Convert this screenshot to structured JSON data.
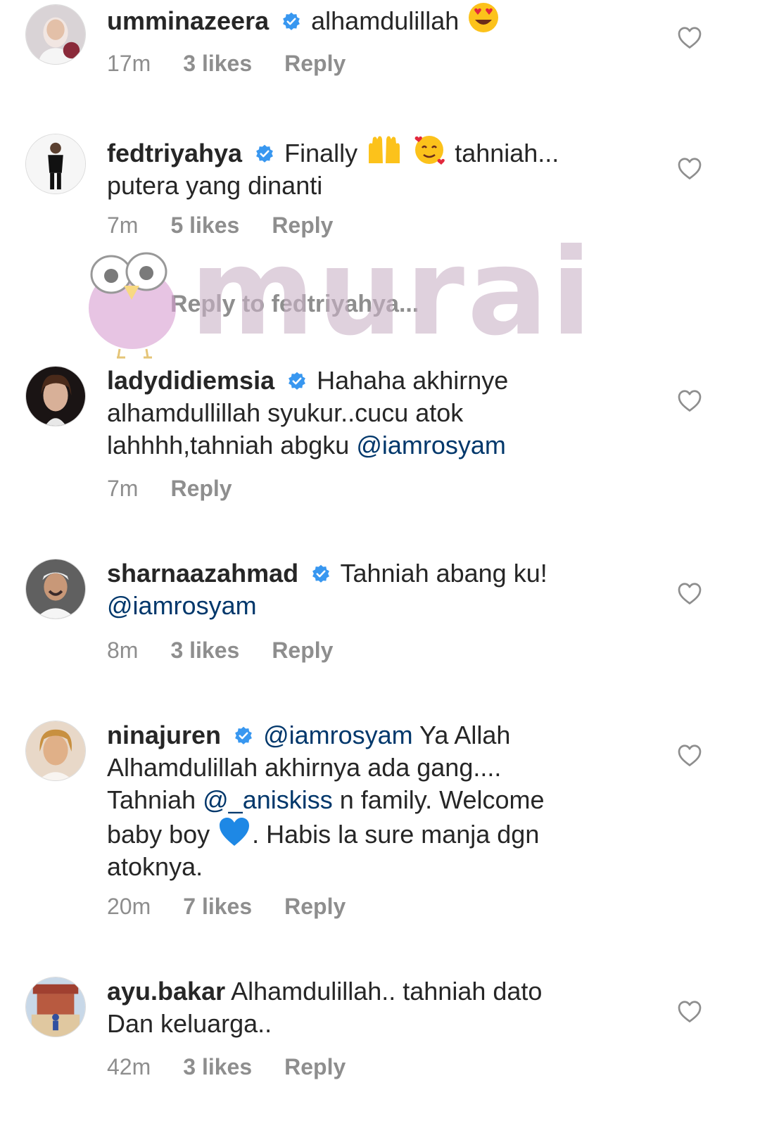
{
  "comments": [
    {
      "username": "umminazeera",
      "verified": true,
      "text": "alhamdulillah",
      "emojis": [
        "heart-eyes"
      ],
      "time": "17m",
      "likes": "3 likes",
      "reply": "Reply",
      "avatar_color": "#7a4a5a"
    },
    {
      "username": "fedtriyahya",
      "verified": true,
      "text_lines": [
        "Finally",
        "tahniah...",
        "putera yang dinanti"
      ],
      "emojis": [
        "raised-hands",
        "smiling-hearts"
      ],
      "time": "7m",
      "likes": "5 likes",
      "reply": "Reply",
      "avatar_color": "#f2f2f2"
    },
    {
      "username": "ladydidiemsia",
      "verified": true,
      "text_lines": [
        "Hahaha akhirnye",
        "alhamdullillah syukur..cucu atok",
        "lahhhh,tahniah abgku"
      ],
      "mention": "@iamrosyam",
      "time": "7m",
      "reply": "Reply",
      "avatar_color": "#2d2020"
    },
    {
      "username": "sharnaazahmad",
      "verified": true,
      "text": "Tahniah abang ku!",
      "mention": "@iamrosyam",
      "time": "8m",
      "likes": "3 likes",
      "reply": "Reply",
      "avatar_color": "#3a3a3a"
    },
    {
      "username": "ninajuren",
      "verified": true,
      "mention1": "@iamrosyam",
      "text_lines": [
        "Ya Allah",
        "Alhamdulillah akhirnya ada gang....",
        "Tahniah",
        "n family. Welcome",
        "baby boy",
        ". Habis la sure manja dgn",
        "atoknya."
      ],
      "mention2": "@_aniskiss",
      "emojis": [
        "blue-heart"
      ],
      "time": "20m",
      "likes": "7 likes",
      "reply": "Reply",
      "avatar_color": "#c99a6e"
    },
    {
      "username": "ayu.bakar",
      "verified": false,
      "text_lines": [
        "Alhamdulillah.. tahniah dato",
        "Dan keluarga.."
      ],
      "time": "42m",
      "likes": "3 likes",
      "reply": "Reply",
      "avatar_color": "#b04838"
    }
  ],
  "view_replies": "Reply to fedtriyahya...",
  "watermark": {
    "text": "murai",
    "color": "#cbb3c8"
  },
  "colors": {
    "text": "#262626",
    "meta": "#8e8e8e",
    "mention": "#00376b",
    "verified": "#3897f0"
  }
}
